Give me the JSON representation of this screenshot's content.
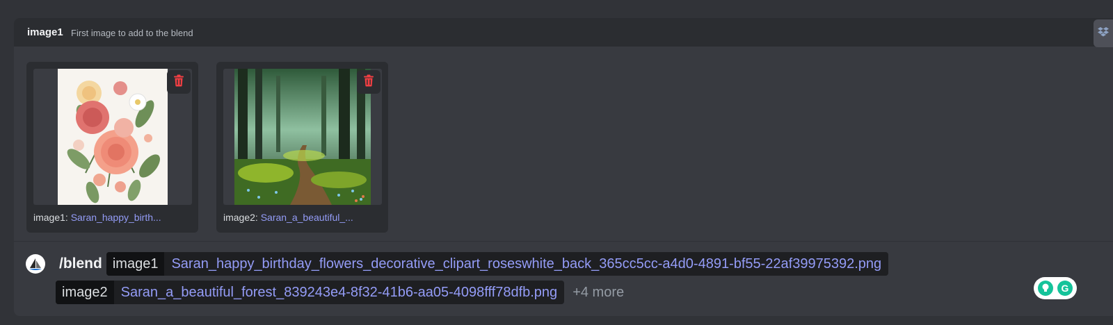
{
  "option_header": {
    "name": "image1",
    "description": "First image to add to the blend"
  },
  "attachments": [
    {
      "label": "image1:",
      "filename": "Saran_happy_birth...",
      "thumbnail": "flower-bouquet-image",
      "delete_icon": "trash-icon"
    },
    {
      "label": "image2:",
      "filename": "Saran_a_beautiful_...",
      "thumbnail": "forest-path-image",
      "delete_icon": "trash-icon"
    }
  ],
  "command": {
    "name": "/blend",
    "bot_avatar": "midjourney-bot-avatar",
    "options": [
      {
        "name": "image1",
        "value": "Saran_happy_birthday_flowers_decorative_clipart_roseswhite_back_365cc5cc-a4d0-4891-bf55-22af39975392.png"
      },
      {
        "name": "image2",
        "value": "Saran_a_beautiful_forest_839243e4-8f32-41b6-aa05-4098fff78dfb.png"
      }
    ],
    "more": "+4 more"
  },
  "colors": {
    "delete": "#f23f43",
    "link": "#949cf7",
    "grammarly_green": "#15c39a"
  }
}
